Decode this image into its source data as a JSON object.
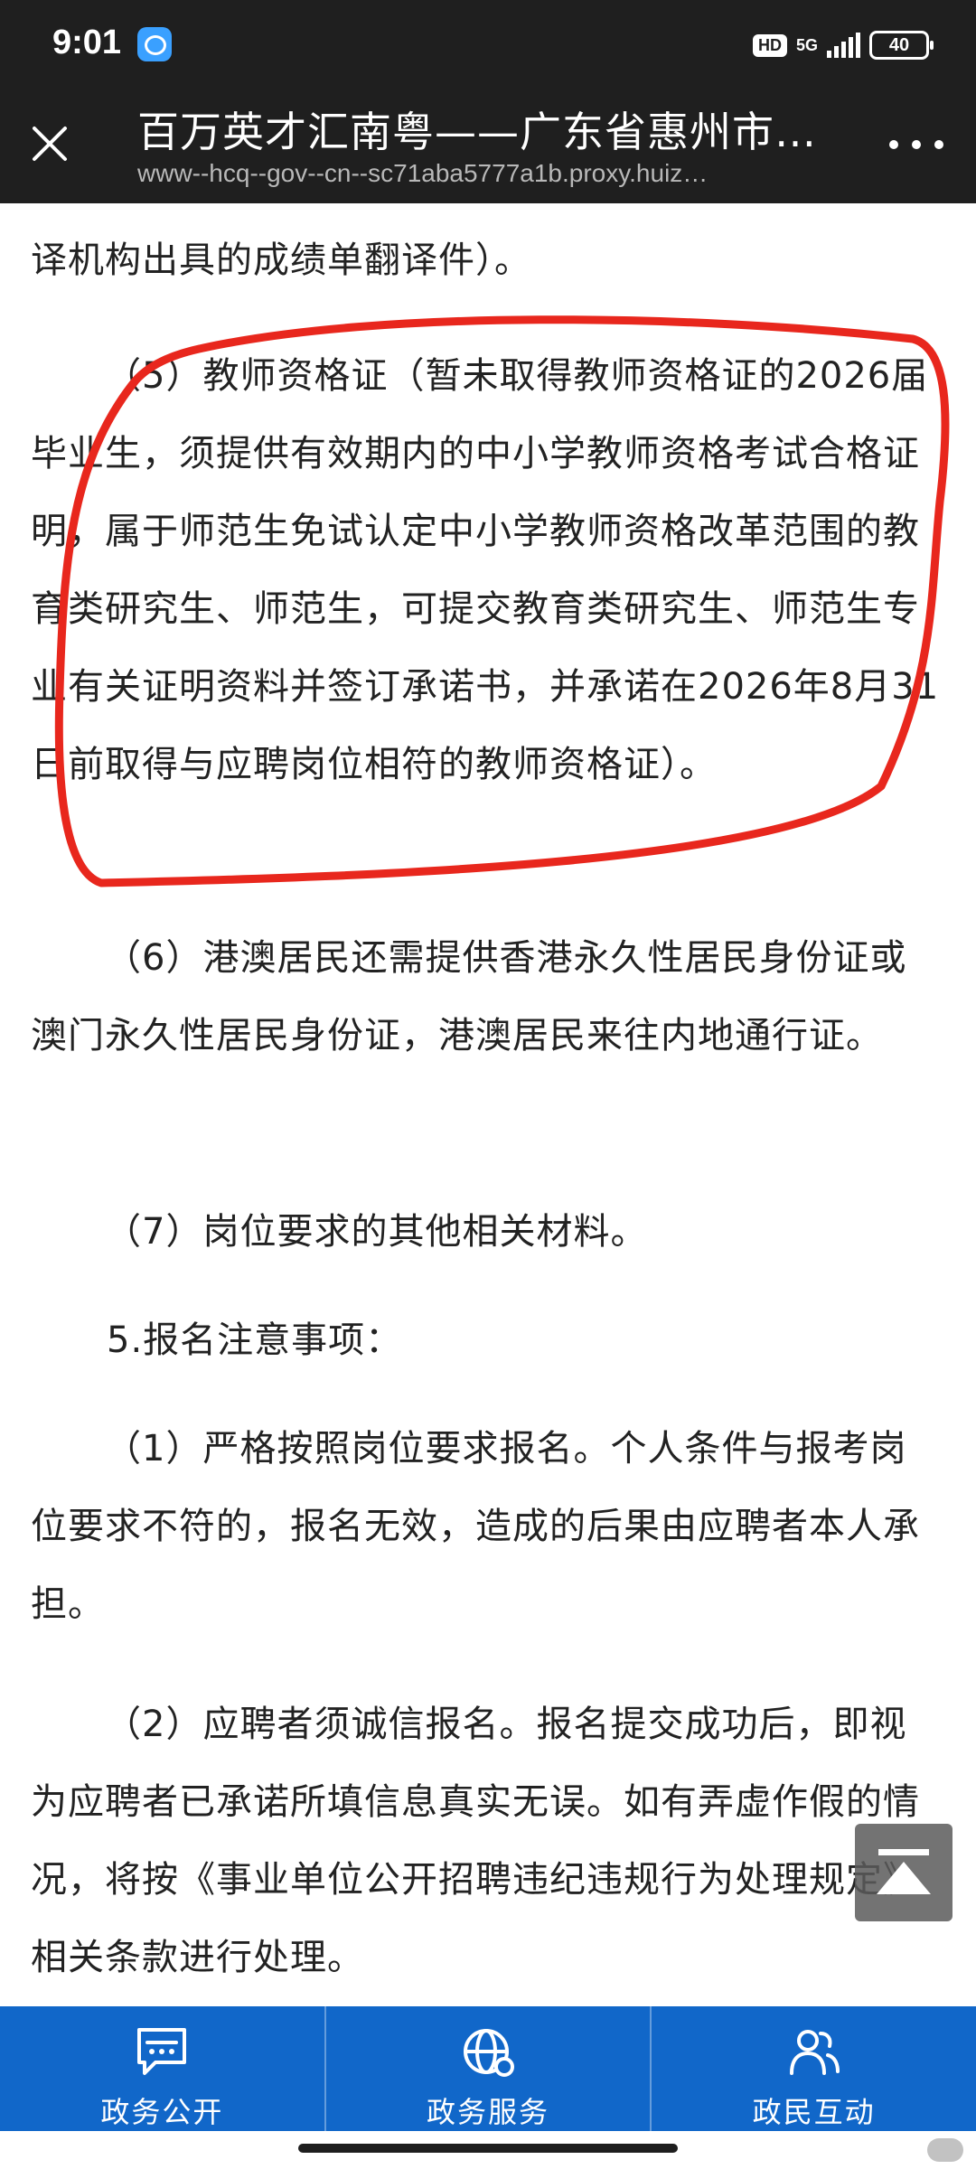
{
  "status_bar": {
    "time": "9:01",
    "hd": "HD",
    "network": "5G",
    "battery": "40"
  },
  "header": {
    "title": "百万英才汇南粤——广东省惠州市…",
    "url": "www--hcq--gov--cn--sc71aba5777a1b.proxy.huiz…"
  },
  "content": {
    "paragraphs": [
      "译机构出具的成绩单翻译件）。",
      "（5）教师资格证（暂未取得教师资格证的2026届毕业生，须提供有效期内的中小学教师资格考试合格证明，属于师范生免试认定中小学教师资格改革范围的教育类研究生、师范生，可提交教育类研究生、师范生专业有关证明资料并签订承诺书，并承诺在2026年8月31日前取得与应聘岗位相符的教师资格证）。",
      "（6）港澳居民还需提供香港永久性居民身份证或澳门永久性居民身份证，港澳居民来往内地通行证。",
      "（7）岗位要求的其他相关材料。",
      "5.报名注意事项：",
      "（1）严格按照岗位要求报名。个人条件与报考岗位要求不符的，报名无效，造成的后果由应聘者本人承担。",
      "（2）应聘者须诚信报名。报名提交成功后，即视为应聘者已承诺所填信息真实无误。如有弄虚作假的情况，将按《事业单位公开招聘违纪违规行为处理规定》相关条款进行处理。"
    ]
  },
  "bottom_nav": {
    "items": [
      {
        "label": "政务公开",
        "icon": "message-icon"
      },
      {
        "label": "政务服务",
        "icon": "globe-icon"
      },
      {
        "label": "政民互动",
        "icon": "people-icon"
      }
    ]
  },
  "colors": {
    "nav_blue": "#1167c9",
    "annotation_red": "#e8271d",
    "dark_bar": "#1f1f1f"
  }
}
